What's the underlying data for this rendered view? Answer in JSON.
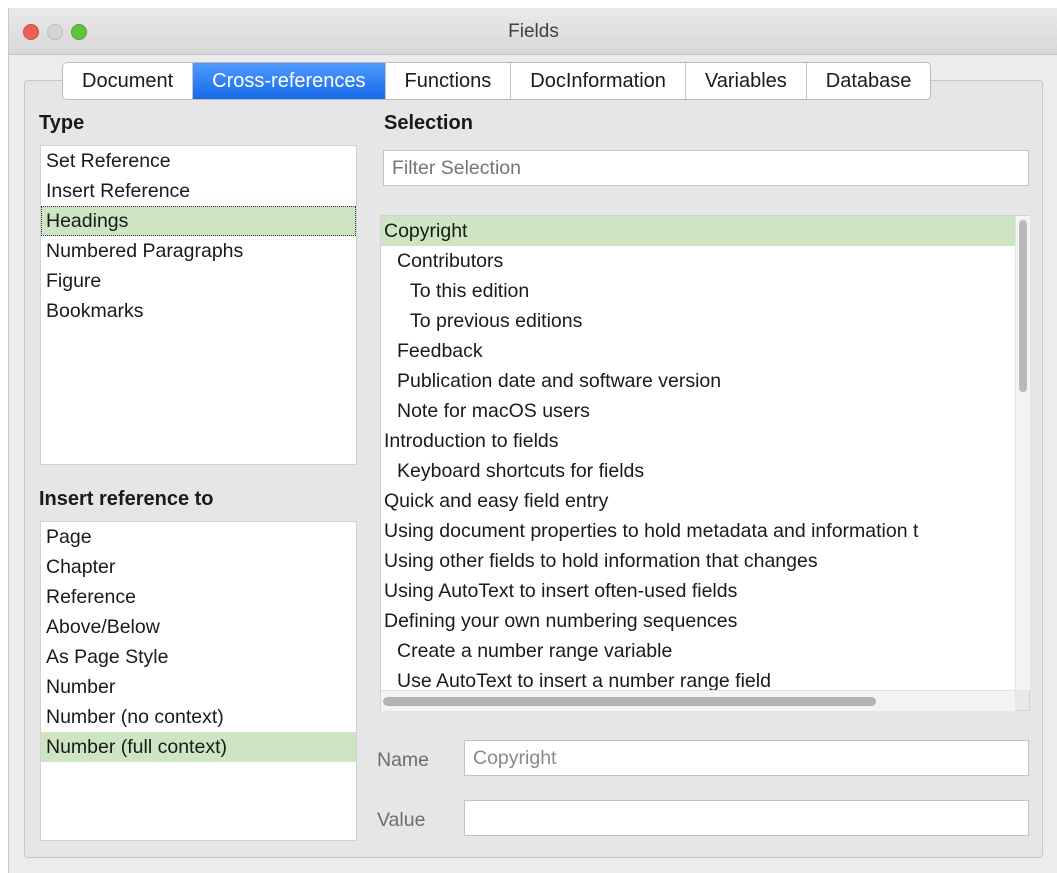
{
  "window": {
    "title": "Fields"
  },
  "tabs": [
    {
      "label": "Document",
      "active": false
    },
    {
      "label": "Cross-references",
      "active": true
    },
    {
      "label": "Functions",
      "active": false
    },
    {
      "label": "DocInformation",
      "active": false
    },
    {
      "label": "Variables",
      "active": false
    },
    {
      "label": "Database",
      "active": false
    }
  ],
  "type_section": {
    "label": "Type",
    "items": [
      "Set Reference",
      "Insert Reference",
      "Headings",
      "Numbered Paragraphs",
      "Figure",
      "Bookmarks"
    ],
    "selected_index": 2
  },
  "insert_ref_section": {
    "label": "Insert reference to",
    "items": [
      "Page",
      "Chapter",
      "Reference",
      "Above/Below",
      "As Page Style",
      "Number",
      "Number (no context)",
      "Number (full context)"
    ],
    "selected_index": 7
  },
  "selection_section": {
    "label": "Selection",
    "filter_placeholder": "Filter Selection",
    "items": [
      "Copyright",
      "Contributors",
      "To this edition",
      "To previous editions",
      "Feedback",
      "Publication date and software version",
      "Note for macOS users",
      "Introduction to fields",
      "Keyboard shortcuts for fields",
      "Quick and easy field entry",
      "Using document properties to hold metadata and information t",
      "Using other fields to hold information that changes",
      "Using AutoText to insert often-used fields",
      "Defining your own numbering sequences",
      "Create a number range variable",
      "Use AutoText to insert a number range field"
    ],
    "levels": [
      0,
      1,
      2,
      2,
      1,
      1,
      1,
      0,
      1,
      0,
      0,
      0,
      0,
      0,
      1,
      1
    ],
    "selected_index": 0
  },
  "name_field": {
    "label": "Name",
    "value": "Copyright"
  },
  "value_field": {
    "label": "Value",
    "value": ""
  },
  "colors": {
    "selection_highlight": "#cde5c2",
    "tab_active": "#1769e8"
  }
}
